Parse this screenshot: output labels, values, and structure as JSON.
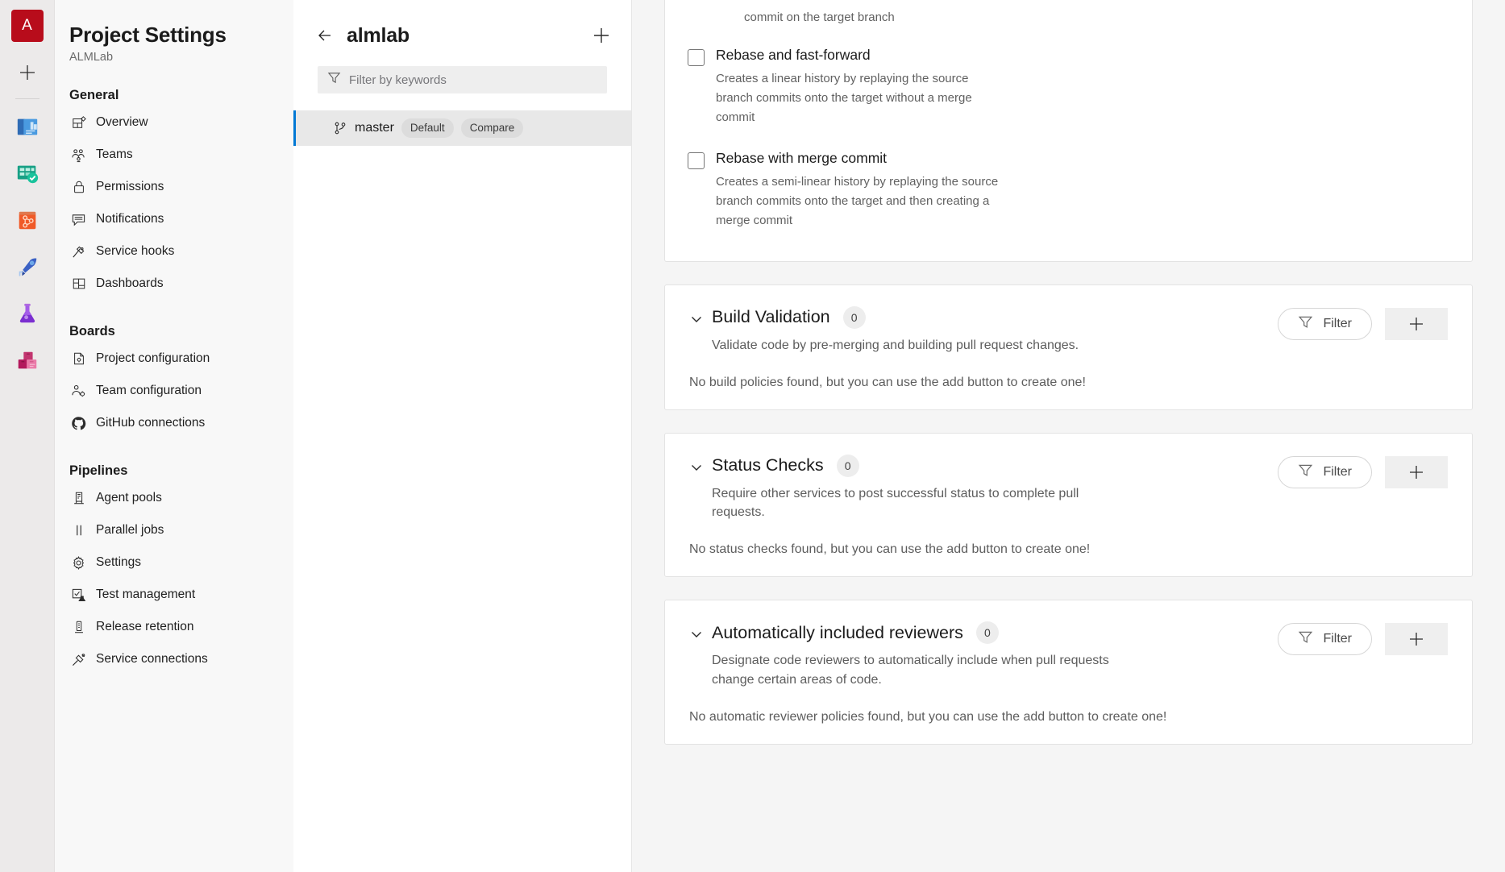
{
  "rail": {
    "org_initial": "A",
    "add_label": "+",
    "items": [
      {
        "name": "overview-service-icon",
        "title": "Overview"
      },
      {
        "name": "boards-service-icon",
        "title": "Boards"
      },
      {
        "name": "repos-service-icon",
        "title": "Repos"
      },
      {
        "name": "pipelines-service-icon",
        "title": "Pipelines"
      },
      {
        "name": "test-plans-service-icon",
        "title": "Test Plans"
      },
      {
        "name": "artifacts-service-icon",
        "title": "Artifacts"
      }
    ]
  },
  "sidebar": {
    "title": "Project Settings",
    "subtitle": "ALMLab",
    "groups": [
      {
        "label": "General",
        "items": [
          {
            "label": "Overview",
            "icon": "overview-icon"
          },
          {
            "label": "Teams",
            "icon": "teams-icon"
          },
          {
            "label": "Permissions",
            "icon": "lock-icon"
          },
          {
            "label": "Notifications",
            "icon": "notifications-icon"
          },
          {
            "label": "Service hooks",
            "icon": "service-hooks-icon"
          },
          {
            "label": "Dashboards",
            "icon": "dashboards-icon"
          }
        ]
      },
      {
        "label": "Boards",
        "items": [
          {
            "label": "Project configuration",
            "icon": "project-configuration-icon"
          },
          {
            "label": "Team configuration",
            "icon": "team-configuration-icon"
          },
          {
            "label": "GitHub connections",
            "icon": "github-icon"
          }
        ]
      },
      {
        "label": "Pipelines",
        "items": [
          {
            "label": "Agent pools",
            "icon": "agent-pools-icon"
          },
          {
            "label": "Parallel jobs",
            "icon": "parallel-jobs-icon"
          },
          {
            "label": "Settings",
            "icon": "gear-icon"
          },
          {
            "label": "Test management",
            "icon": "test-management-icon"
          },
          {
            "label": "Release retention",
            "icon": "release-retention-icon"
          },
          {
            "label": "Service connections",
            "icon": "service-connections-icon"
          }
        ]
      }
    ]
  },
  "branches": {
    "title": "almlab",
    "back_icon": "back-arrow-icon",
    "add_icon": "plus-icon",
    "filter_placeholder": "Filter by keywords",
    "filter_value": "",
    "rows": [
      {
        "name": "master",
        "badges": [
          "Default",
          "Compare"
        ]
      }
    ]
  },
  "merge_strategies": {
    "clipped_desc_line": "commit on the target branch",
    "options": [
      {
        "label": "Rebase and fast-forward",
        "desc": "Creates a linear history by replaying the source branch commits onto the target without a merge commit",
        "checked": false
      },
      {
        "label": "Rebase with merge commit",
        "desc": "Creates a semi-linear history by replaying the source branch commits onto the target and then creating a merge commit",
        "checked": false
      }
    ]
  },
  "policy_sections": [
    {
      "title": "Build Validation",
      "count": "0",
      "desc": "Validate code by pre-merging and building pull request changes.",
      "empty": "No build policies found, but you can use the add button to create one!",
      "filter_label": "Filter",
      "add_label": "+"
    },
    {
      "title": "Status Checks",
      "count": "0",
      "desc": "Require other services to post successful status to complete pull requests.",
      "empty": "No status checks found, but you can use the add button to create one!",
      "filter_label": "Filter",
      "add_label": "+"
    },
    {
      "title": "Automatically included reviewers",
      "count": "0",
      "desc": "Designate code reviewers to automatically include when pull requests change certain areas of code.",
      "empty": "No automatic reviewer policies found, but you can use the add button to create one!",
      "filter_label": "Filter",
      "add_label": "+"
    }
  ],
  "colors": {
    "accent": "#0078d4",
    "org_badge": "#b80c1b",
    "page_bg": "#f5f5f5"
  }
}
